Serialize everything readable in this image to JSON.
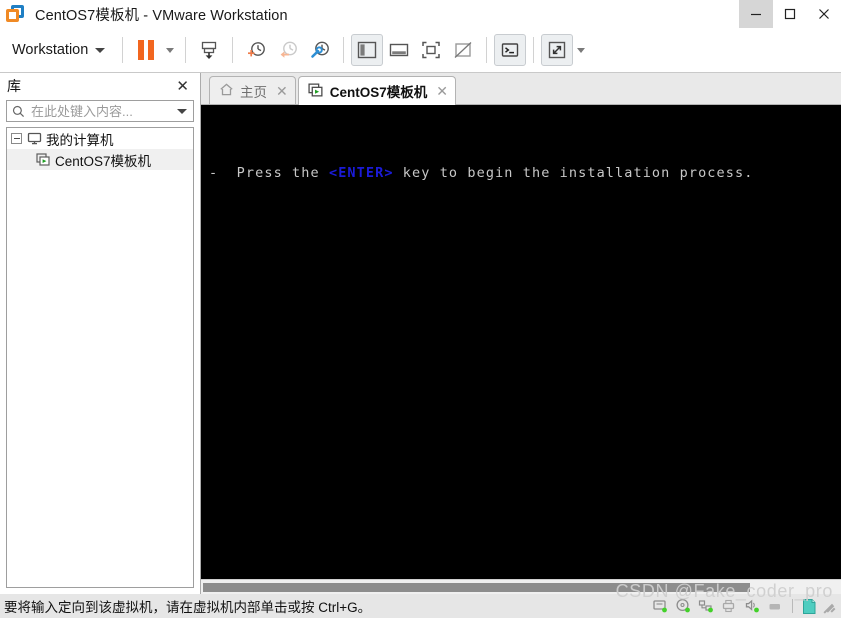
{
  "window": {
    "title": "CentOS7模板机 - VMware Workstation",
    "logo_icon": "vmware-logo-icon",
    "controls": {
      "minimize": "minimize-icon",
      "maximize": "maximize-icon",
      "close": "close-icon"
    }
  },
  "toolbar": {
    "workstation_menu": "Workstation",
    "items": [
      {
        "name": "suspend-button",
        "icon": "pause-icon"
      },
      {
        "name": "suspend-dropdown",
        "icon": "chevron-down-icon"
      },
      {
        "name": "power-button",
        "icon": "power-vm-icon"
      },
      {
        "name": "take-snapshot-button",
        "icon": "snapshot-add-icon"
      },
      {
        "name": "revert-snapshot-button",
        "icon": "snapshot-revert-icon"
      },
      {
        "name": "snapshot-manager-button",
        "icon": "snapshot-manager-icon"
      },
      {
        "name": "show-library-button",
        "icon": "library-panel-icon"
      },
      {
        "name": "show-thumbnails-button",
        "icon": "thumbnail-bar-icon"
      },
      {
        "name": "fit-guest-button",
        "icon": "fit-guest-icon"
      },
      {
        "name": "fit-window-button",
        "icon": "fit-window-icon"
      },
      {
        "name": "console-view-button",
        "icon": "console-icon"
      },
      {
        "name": "fullscreen-button",
        "icon": "fullscreen-icon"
      },
      {
        "name": "fullscreen-dropdown",
        "icon": "chevron-down-icon"
      }
    ]
  },
  "sidebar": {
    "title": "库",
    "close_icon": "close-icon",
    "search": {
      "placeholder": "在此处键入内容...",
      "value": "",
      "icon": "search-icon",
      "dropdown_icon": "chevron-down-icon"
    },
    "tree": [
      {
        "label": "我的计算机",
        "icon": "my-computer-icon",
        "expanded": true,
        "selected": false
      },
      {
        "label": "CentOS7模板机",
        "icon": "virtual-machine-icon",
        "expanded": false,
        "selected": true
      }
    ]
  },
  "tabs": [
    {
      "label": "主页",
      "icon": "home-icon",
      "active": false,
      "close_icon": "close-icon"
    },
    {
      "label": "CentOS7模板机",
      "icon": "virtual-machine-icon",
      "active": true,
      "close_icon": "close-icon"
    }
  ],
  "console": {
    "background": "#000000",
    "line_prefix": "-  Press the ",
    "line_key": "<ENTER>",
    "line_suffix": " key to begin the installation process.",
    "key_color": "#1b1bd8",
    "text_color": "#c8c8c8"
  },
  "scrollbar": {
    "orientation": "horizontal",
    "thumb_percent": 86
  },
  "statusbar": {
    "message": "要将输入定向到该虚拟机，请在虚拟机内部单击或按 Ctrl+G。",
    "devices": [
      {
        "name": "hard-disk-icon",
        "connected": true
      },
      {
        "name": "cd-dvd-icon",
        "connected": true
      },
      {
        "name": "network-adapter-icon",
        "connected": true
      },
      {
        "name": "usb-device-icon",
        "connected": true
      },
      {
        "name": "sound-card-icon",
        "connected": true
      },
      {
        "name": "printer-icon",
        "connected": false
      }
    ],
    "snapshot_icon": "snapshot-document-icon",
    "resize_grip": "resize-grip-icon"
  },
  "watermark": {
    "text": "CSDN @Fake_coder_pro"
  }
}
